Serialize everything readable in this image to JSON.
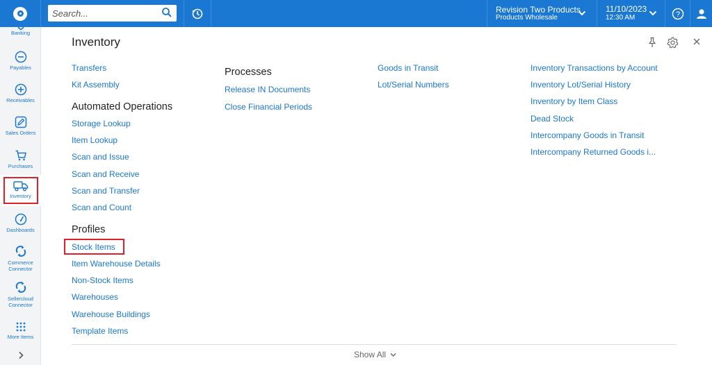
{
  "topbar": {
    "search_placeholder": "Search...",
    "branch_name": "Revision Two Products",
    "branch_sub": "Products Wholesale",
    "date": "11/10/2023",
    "time": "12:30 AM"
  },
  "sidebar": {
    "items": [
      {
        "label": "Banking",
        "icon": "bank-icon"
      },
      {
        "label": "Payables",
        "icon": "minus-circle-icon"
      },
      {
        "label": "Receivables",
        "icon": "plus-circle-icon"
      },
      {
        "label": "Sales Orders",
        "icon": "pencil-icon"
      },
      {
        "label": "Purchases",
        "icon": "cart-icon"
      },
      {
        "label": "Inventory",
        "icon": "truck-icon"
      },
      {
        "label": "Dashboards",
        "icon": "gauge-icon"
      },
      {
        "label_1": "Commerce",
        "label_2": "Connector",
        "icon": "sync-icon"
      },
      {
        "label_1": "Sellercloud",
        "label_2": "Connector",
        "icon": "sync-icon"
      },
      {
        "label": "More Items",
        "icon": "grid-icon"
      }
    ]
  },
  "main": {
    "title": "Inventory",
    "col1_links_top": [
      "Transfers",
      "Kit Assembly"
    ],
    "col1_heading_auto": "Automated Operations",
    "col1_links_auto": [
      "Storage Lookup",
      "Item Lookup",
      "Scan and Issue",
      "Scan and Receive",
      "Scan and Transfer",
      "Scan and Count"
    ],
    "col1_heading_profiles": "Profiles",
    "col1_links_profiles": [
      "Stock Items",
      "Item Warehouse Details",
      "Non-Stock Items",
      "Warehouses",
      "Warehouse Buildings",
      "Template Items"
    ],
    "col2_heading": "Processes",
    "col2_links": [
      "Release IN Documents",
      "Close Financial Periods"
    ],
    "col3_links": [
      "Goods in Transit",
      "Lot/Serial Numbers"
    ],
    "col4_links": [
      "Inventory Transactions by Account",
      "Inventory Lot/Serial History",
      "Inventory by Item Class",
      "Dead Stock",
      "Intercompany Goods in Transit",
      "Intercompany Returned Goods i..."
    ],
    "show_all": "Show All"
  },
  "colors": {
    "brand": "#1a77d2",
    "highlight": "#e41e26"
  }
}
